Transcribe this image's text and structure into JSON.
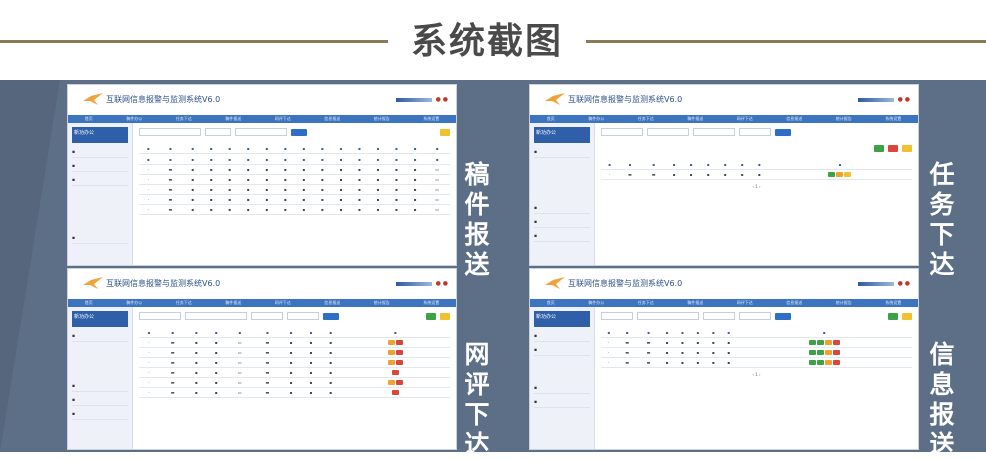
{
  "page_title": "系统截图",
  "app_title": "互联网信息报警与监测系统V6.0",
  "nav_items": [
    "首页",
    "稿件办公",
    "任务下达",
    "稿件报送",
    "网评下达",
    "信息报送",
    "统计报告",
    "系统设置"
  ],
  "sidebar_header": "新功办公",
  "sections": [
    {
      "label": "稿件报送"
    },
    {
      "label": "任务下达"
    },
    {
      "label": "网评下达"
    },
    {
      "label": "信息报送"
    }
  ],
  "colors": {
    "panel": "#5d6f87",
    "stripe": "#3e4c60",
    "accent": "#2d6fc4",
    "header_line": "#8a7b58"
  }
}
